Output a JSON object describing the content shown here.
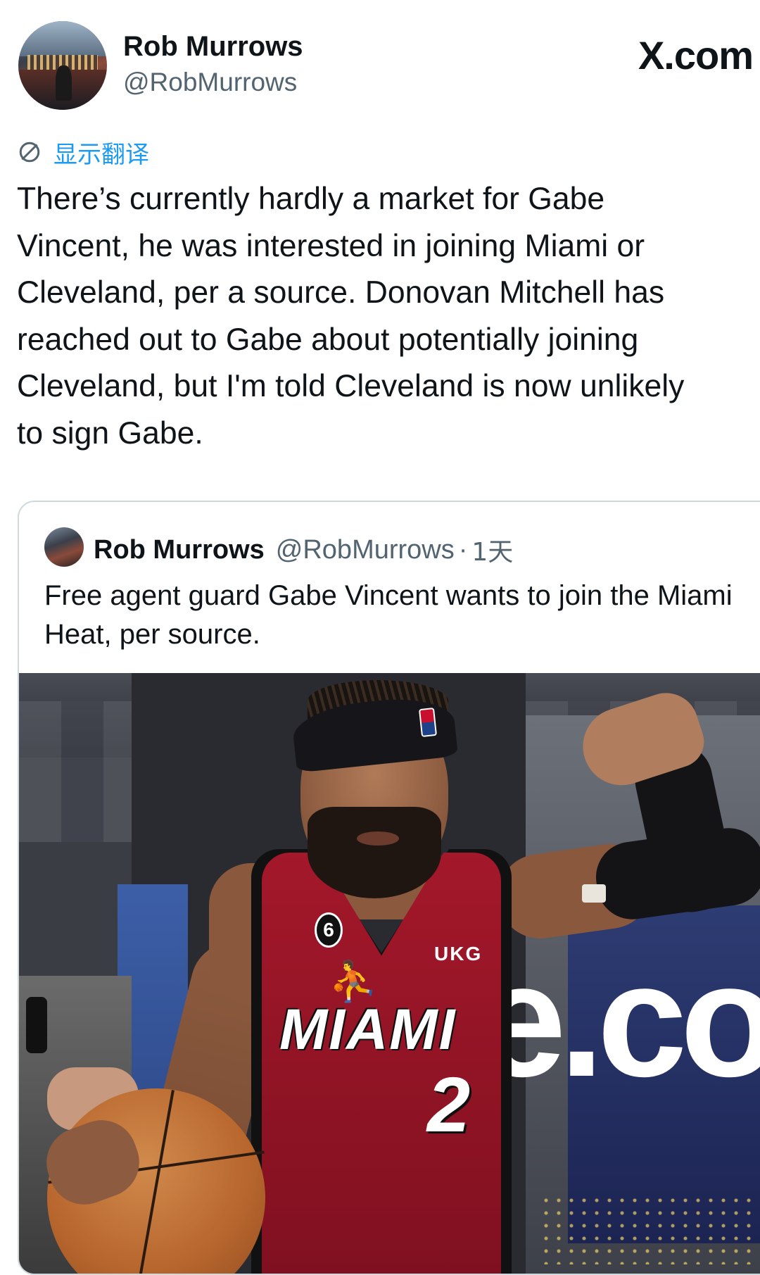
{
  "author": {
    "name": "Rob Murrows",
    "handle": "@RobMurrows",
    "avatar_icon": "profile-photo"
  },
  "brand": "X.com",
  "translate": {
    "label": "显示翻译",
    "icon": "translate-globe-icon",
    "color": "#1d9bf0"
  },
  "tweet": {
    "text": "There’s currently hardly a market for Gabe\nVincent, he was interested in joining Miami or\nCleveland, per a source. Donovan Mitchell has\nreached out to Gabe about potentially joining\nCleveland, but I'm told Cleveland is now unlikely\nto sign Gabe."
  },
  "quote": {
    "name": "Rob Murrows",
    "handle": "@RobMurrows",
    "separator": "·",
    "time": "1天",
    "text": "Free agent guard Gabe Vincent wants to join the Miami Heat, per source."
  },
  "photo": {
    "patch_number": "6",
    "sponsor": "UKG",
    "team": "MIAMI",
    "jersey_number": "2",
    "board_text": "ie.co"
  },
  "colors": {
    "text_primary": "#0f1419",
    "text_secondary": "#536471",
    "border": "#cfd9de",
    "accent": "#1d9bf0"
  }
}
